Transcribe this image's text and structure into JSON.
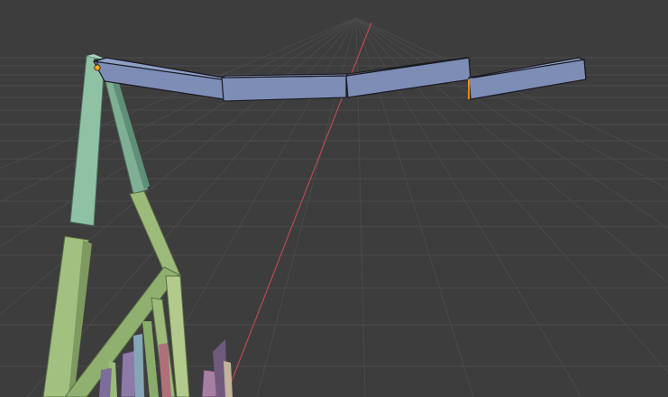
{
  "viewport": {
    "editor": "3D Viewport",
    "background_color": "#3d3d3d",
    "grid": true,
    "grid_color": "#4a4a4a",
    "x_axis_color": "#b84a55"
  },
  "objects": [
    {
      "name": "selected-beam-chain",
      "color": "#7d8db5",
      "edge_color": "#1a1a22",
      "selected": true
    },
    {
      "name": "green-frame",
      "color": "#8fc2a5"
    },
    {
      "name": "olive-struts",
      "color": "#9cbb7a"
    },
    {
      "name": "purple-pieces",
      "color": "#8e7aa8"
    }
  ],
  "selection": {
    "origin_color": "#f5a623",
    "active_edge_color": "#f08a00"
  }
}
